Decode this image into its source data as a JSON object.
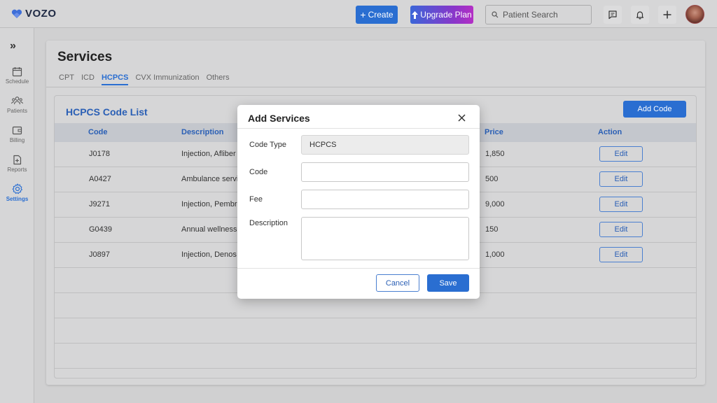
{
  "app": {
    "brand": "VOZO"
  },
  "header": {
    "create_label": "Create",
    "upgrade_label": "Upgrade Plan",
    "search_placeholder": "Patient Search"
  },
  "sidebar": {
    "items": [
      {
        "label": "Schedule",
        "icon": "calendar-icon"
      },
      {
        "label": "Patients",
        "icon": "patients-icon"
      },
      {
        "label": "Billing",
        "icon": "wallet-icon"
      },
      {
        "label": "Reports",
        "icon": "report-icon"
      },
      {
        "label": "Settings",
        "icon": "gear-icon",
        "active": true
      }
    ]
  },
  "page": {
    "title": "Services",
    "tabs": [
      "CPT",
      "ICD",
      "HCPCS",
      "CVX Immunization",
      "Others"
    ],
    "active_tab": "HCPCS"
  },
  "list": {
    "title": "HCPCS Code List",
    "add_label": "Add Code",
    "columns": [
      "Code",
      "Description",
      "Price",
      "Action"
    ],
    "rows": [
      {
        "code": "J0178",
        "description": "Injection, Afliber",
        "price": "1,850",
        "action": "Edit"
      },
      {
        "code": "A0427",
        "description": "Ambulance servi",
        "price": "500",
        "action": "Edit"
      },
      {
        "code": "J9271",
        "description": "Injection, Pembr",
        "price": "9,000",
        "action": "Edit"
      },
      {
        "code": "G0439",
        "description": "Annual wellness",
        "price": "150",
        "action": "Edit"
      },
      {
        "code": "J0897",
        "description": "Injection, Denos",
        "price": "1,000",
        "action": "Edit"
      }
    ]
  },
  "modal": {
    "title": "Add Services",
    "code_type_label": "Code Type",
    "code_type_value": "HCPCS",
    "code_label": "Code",
    "code_value": "",
    "fee_label": "Fee",
    "fee_value": "",
    "description_label": "Description",
    "description_value": "",
    "cancel_label": "Cancel",
    "save_label": "Save"
  },
  "colors": {
    "accent": "#2a6ed1",
    "title_blue": "#2a5fb5"
  }
}
